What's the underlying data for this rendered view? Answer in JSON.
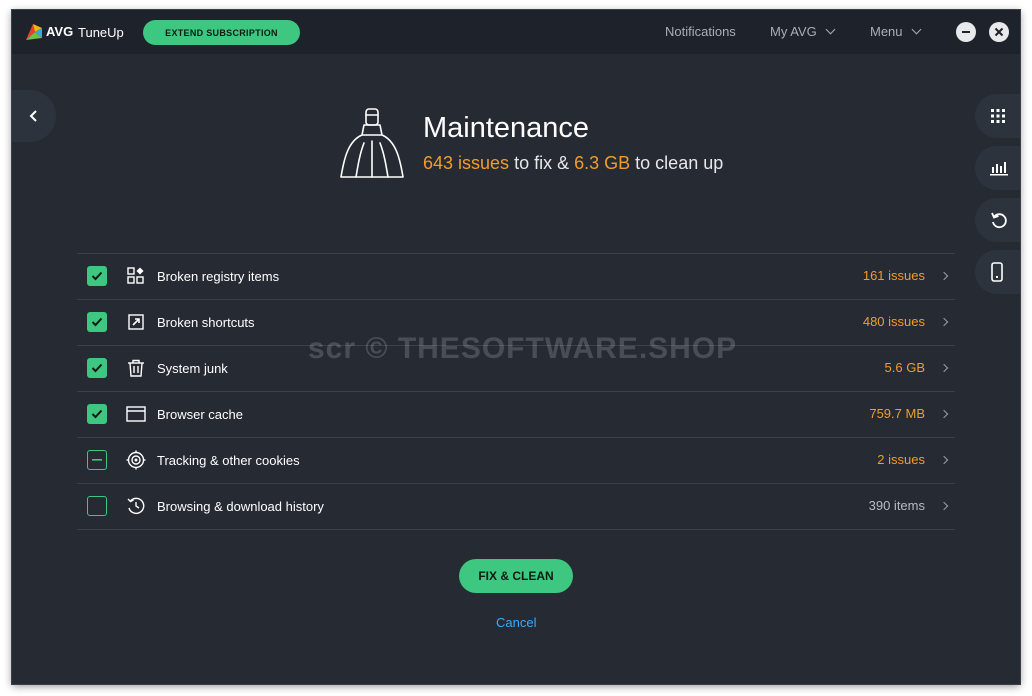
{
  "app": {
    "brand": "AVG",
    "product": "TuneUp",
    "extend_label": "EXTEND SUBSCRIPTION"
  },
  "topnav": {
    "notifications": "Notifications",
    "my_avg": "My AVG",
    "menu": "Menu"
  },
  "hero": {
    "title": "Maintenance",
    "issues_count": "643 issues",
    "mid_text": "to fix &",
    "size": "6.3 GB",
    "end_text": "to clean up"
  },
  "items": [
    {
      "label": "Broken registry items",
      "value": "161 issues",
      "state": "checked",
      "icon": "registry-icon"
    },
    {
      "label": "Broken shortcuts",
      "value": "480 issues",
      "state": "checked",
      "icon": "shortcut-icon"
    },
    {
      "label": "System junk",
      "value": "5.6 GB",
      "state": "checked",
      "icon": "trash-icon"
    },
    {
      "label": "Browser cache",
      "value": "759.7 MB",
      "state": "checked",
      "icon": "browser-window-icon"
    },
    {
      "label": "Tracking & other cookies",
      "value": "2 issues",
      "state": "partial",
      "icon": "target-icon"
    },
    {
      "label": "Browsing & download history",
      "value": "390 items",
      "state": "unchecked",
      "icon": "history-icon"
    }
  ],
  "actions": {
    "fix_label": "FIX & CLEAN",
    "cancel_label": "Cancel"
  },
  "watermark": "scr © THESOFTWARE.SHOP",
  "colors": {
    "accent_green": "#3dc780",
    "highlight_orange": "#f39c2c",
    "link_blue": "#3fa9f5",
    "background": "#252a33"
  }
}
